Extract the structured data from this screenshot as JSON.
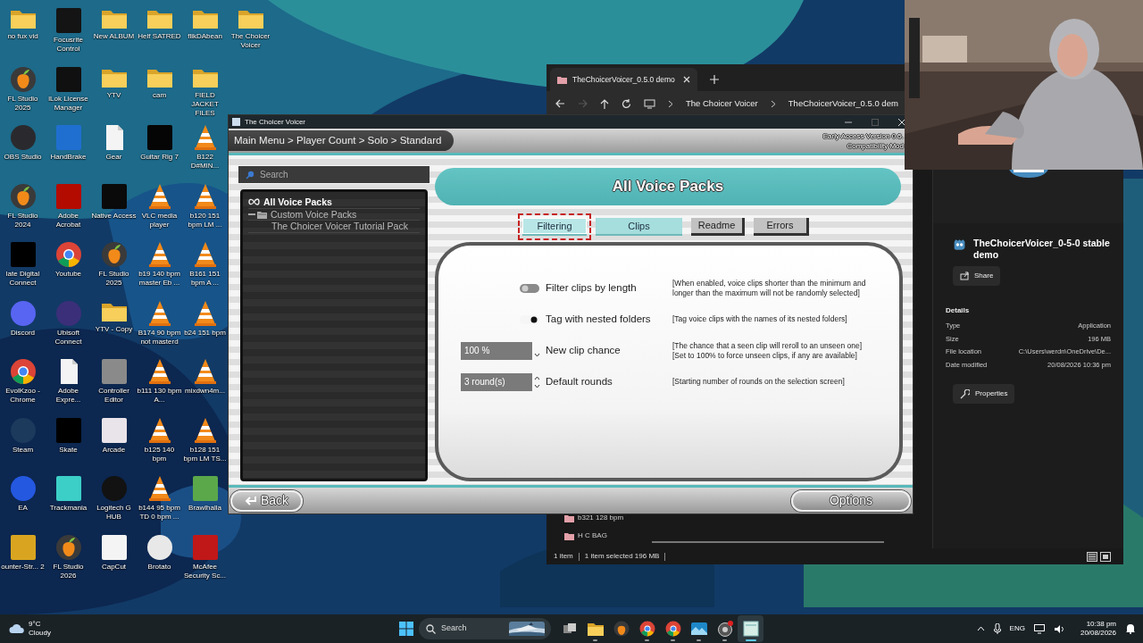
{
  "desktop": {
    "rows": [
      [
        {
          "label": "no fux vid",
          "kind": "folder"
        },
        {
          "label": "Focusrite Control",
          "kind": "tile",
          "color": "#141414"
        },
        {
          "label": "New ALBUM",
          "kind": "folder"
        },
        {
          "label": "Helf SATRED",
          "kind": "folder"
        },
        {
          "label": "flikDAbean",
          "kind": "folder"
        },
        {
          "label": "The Choicer Voicer",
          "kind": "folder"
        }
      ],
      [
        {
          "label": "FL Studio 2025",
          "kind": "fruit"
        },
        {
          "label": "iLok License Manager",
          "kind": "tile",
          "color": "#101010"
        },
        {
          "label": "YTV",
          "kind": "folder"
        },
        {
          "label": "cam",
          "kind": "folder"
        },
        {
          "label": "FIELD JACKET FILES",
          "kind": "folder"
        }
      ],
      [
        {
          "label": "OBS Studio",
          "kind": "round",
          "color": "#2a2a2e"
        },
        {
          "label": "HandBrake",
          "kind": "tile",
          "color": "#1f6fd0"
        },
        {
          "label": "Gear",
          "kind": "doc"
        },
        {
          "label": "Guitar Rig 7",
          "kind": "tile",
          "color": "#050505"
        },
        {
          "label": "B122 D#MIN...",
          "kind": "cone"
        }
      ],
      [
        {
          "label": "FL Studio 2024",
          "kind": "fruit"
        },
        {
          "label": "Adobe Acrobat",
          "kind": "tile",
          "color": "#b30b00"
        },
        {
          "label": "Native Access",
          "kind": "tile",
          "color": "#0a0a0a"
        },
        {
          "label": "VLC media player",
          "kind": "cone"
        },
        {
          "label": "b120 151 bpm LM ...",
          "kind": "cone"
        }
      ],
      [
        {
          "label": "late Digital Connect",
          "kind": "tile",
          "color": "#000000"
        },
        {
          "label": "Youtube",
          "kind": "chrome"
        },
        {
          "label": "FL Studio 2025",
          "kind": "fruit"
        },
        {
          "label": "b19 140 bpm master Eb ...",
          "kind": "cone"
        },
        {
          "label": "B161 151 bpm A ...",
          "kind": "cone"
        }
      ],
      [
        {
          "label": "Discord",
          "kind": "round",
          "color": "#5865f2"
        },
        {
          "label": "Ubisoft Connect",
          "kind": "round",
          "color": "#3b2f7a"
        },
        {
          "label": "YTV - Copy",
          "kind": "folder"
        },
        {
          "label": "B174 90 bpm not masterd",
          "kind": "cone"
        },
        {
          "label": "b24 151 bpm",
          "kind": "cone"
        }
      ],
      [
        {
          "label": "EvolKzoo - Chrome",
          "kind": "chrome"
        },
        {
          "label": "Adobe Expre...",
          "kind": "doc"
        },
        {
          "label": "Controller Editor",
          "kind": "tile",
          "color": "#8a8a8a"
        },
        {
          "label": "b111 130 bpm A...",
          "kind": "cone"
        },
        {
          "label": "mixdwn4m...",
          "kind": "cone"
        }
      ],
      [
        {
          "label": "Steam",
          "kind": "round",
          "color": "#1b3a5c"
        },
        {
          "label": "Skate",
          "kind": "tile",
          "color": "#000000"
        },
        {
          "label": "Arcade",
          "kind": "tile",
          "color": "#e9e4ea"
        },
        {
          "label": "b125 140 bpm",
          "kind": "cone"
        },
        {
          "label": "b128 151 bpm LM TS...",
          "kind": "cone"
        }
      ],
      [
        {
          "label": "EA",
          "kind": "round",
          "color": "#2458e0"
        },
        {
          "label": "Trackmania",
          "kind": "tile",
          "color": "#3ccfc7"
        },
        {
          "label": "Logitech G HUB",
          "kind": "round",
          "color": "#121212"
        },
        {
          "label": "b144 95 bpm TD 0 bpm ...",
          "kind": "cone"
        },
        {
          "label": "Brawlhalla",
          "kind": "tile",
          "color": "#5aa84a"
        }
      ],
      [
        {
          "label": "ounter-Str... 2",
          "kind": "tile",
          "color": "#d9a520"
        },
        {
          "label": "FL Studio 2026",
          "kind": "fruit"
        },
        {
          "label": "CapCut",
          "kind": "tile",
          "color": "#f4f4f4"
        },
        {
          "label": "Brotato",
          "kind": "round",
          "color": "#e8e8e8"
        },
        {
          "label": "McAfee Security Sc...",
          "kind": "tile",
          "color": "#c01818"
        }
      ]
    ]
  },
  "explorer": {
    "tab_title": "TheChoicerVoicer_0.5.0 demo",
    "forward_disabled": true,
    "path": [
      "The Choicer Voicer",
      "TheChoicerVoicer_0.5.0 dem"
    ],
    "files": [
      "b321 128 bpm",
      "H C BAG"
    ],
    "status": [
      "1 item",
      "1 item selected  196 MB"
    ],
    "details": {
      "name": "TheChoicerVoicer_0-5-0 stable demo",
      "share": "Share",
      "heading": "Details",
      "rows": [
        {
          "label": "Type",
          "value": "Application"
        },
        {
          "label": "Size",
          "value": "196 MB"
        },
        {
          "label": "File location",
          "value": "C:\\Users\\werdn\\OneDrive\\De..."
        },
        {
          "label": "Date modified",
          "value": "20/08/2026 10:36 pm"
        }
      ],
      "properties": "Properties"
    }
  },
  "app": {
    "title": "The Choicer Voicer",
    "breadcrumb": "Main Menu > Player Count > Solo > Standard",
    "version_lines": [
      "Early Access Version 0.5.",
      "Compatibility Mod"
    ],
    "search": {
      "placeholder": "Search"
    },
    "tree": [
      {
        "label": "All Voice Packs",
        "selected": true
      },
      {
        "label": "Custom Voice Packs",
        "selected": false,
        "expanded": true,
        "children": [
          {
            "label": "The Choicer Voicer Tutorial Pack",
            "selected": false
          }
        ]
      }
    ],
    "header": "All Voice Packs",
    "tabs": [
      {
        "label": "Filtering",
        "selected": true,
        "tinted": true
      },
      {
        "label": "Clips",
        "selected": false,
        "tinted": true
      },
      {
        "label": "Readme",
        "selected": false,
        "tinted": false
      },
      {
        "label": "Errors",
        "selected": false,
        "tinted": false
      }
    ],
    "settings": [
      {
        "kind": "toggle",
        "on": false,
        "label": "Filter clips by length",
        "description": "[When enabled, voice clips shorter than the minimum and\nlonger than the maximum will not be randomly selected]"
      },
      {
        "kind": "toggle",
        "on": true,
        "label": "Tag with nested folders",
        "description": "[Tag voice clips with the names of its nested folders]"
      },
      {
        "kind": "spin",
        "value": "100 %",
        "at_max": true,
        "label": "New clip chance",
        "description": "[The chance that a seen clip will reroll to an unseen one]\n[Set to 100% to force unseen clips, if any are available]"
      },
      {
        "kind": "spin",
        "value": "3 round(s)",
        "at_max": false,
        "label": "Default rounds",
        "description": "[Starting number of rounds on the selection screen]"
      }
    ],
    "back": "Back",
    "options": "Options"
  },
  "taskbar": {
    "weather": {
      "temperature": "9°C",
      "condition": "Cloudy"
    },
    "search": {
      "placeholder": "Search"
    },
    "apps": [
      {
        "kind": "taskview",
        "running": false,
        "selected": false
      },
      {
        "kind": "folder",
        "running": true,
        "selected": false
      },
      {
        "kind": "fruit",
        "running": false,
        "selected": false
      },
      {
        "kind": "chrome",
        "running": true,
        "selected": false
      },
      {
        "kind": "chrome",
        "running": true,
        "selected": false
      },
      {
        "kind": "photos",
        "running": true,
        "selected": false
      },
      {
        "kind": "record",
        "running": true,
        "selected": false
      },
      {
        "kind": "window",
        "running": true,
        "selected": true
      }
    ],
    "language": "ENG",
    "time": "10:38 pm",
    "date": "20/08/2026"
  }
}
